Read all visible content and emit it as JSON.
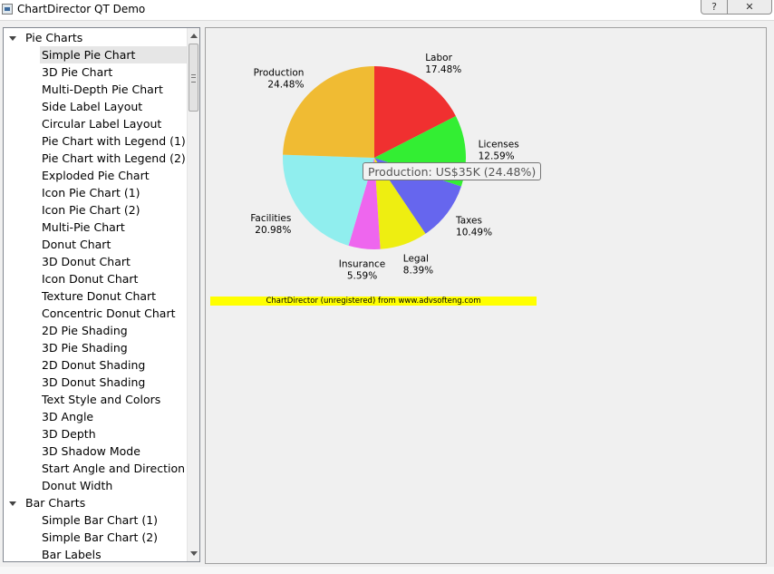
{
  "window": {
    "title": "ChartDirector QT Demo",
    "help_label": "?",
    "close_label": "✕"
  },
  "tree": {
    "rows": [
      {
        "label": "Pie Charts",
        "type": "group"
      },
      {
        "label": "Simple Pie Chart",
        "type": "leaf",
        "selected": true
      },
      {
        "label": "3D Pie Chart",
        "type": "leaf"
      },
      {
        "label": "Multi-Depth Pie Chart",
        "type": "leaf"
      },
      {
        "label": "Side Label Layout",
        "type": "leaf"
      },
      {
        "label": "Circular Label Layout",
        "type": "leaf"
      },
      {
        "label": "Pie Chart with Legend (1)",
        "type": "leaf"
      },
      {
        "label": "Pie Chart with Legend (2)",
        "type": "leaf"
      },
      {
        "label": "Exploded Pie Chart",
        "type": "leaf"
      },
      {
        "label": "Icon Pie Chart (1)",
        "type": "leaf"
      },
      {
        "label": "Icon Pie Chart (2)",
        "type": "leaf"
      },
      {
        "label": "Multi-Pie Chart",
        "type": "leaf"
      },
      {
        "label": "Donut Chart",
        "type": "leaf"
      },
      {
        "label": "3D Donut Chart",
        "type": "leaf"
      },
      {
        "label": "Icon Donut Chart",
        "type": "leaf"
      },
      {
        "label": "Texture Donut Chart",
        "type": "leaf"
      },
      {
        "label": "Concentric Donut Chart",
        "type": "leaf"
      },
      {
        "label": "2D Pie Shading",
        "type": "leaf"
      },
      {
        "label": "3D Pie Shading",
        "type": "leaf"
      },
      {
        "label": "2D Donut Shading",
        "type": "leaf"
      },
      {
        "label": "3D Donut Shading",
        "type": "leaf"
      },
      {
        "label": "Text Style and Colors",
        "type": "leaf"
      },
      {
        "label": "3D Angle",
        "type": "leaf"
      },
      {
        "label": "3D Depth",
        "type": "leaf"
      },
      {
        "label": "3D Shadow Mode",
        "type": "leaf"
      },
      {
        "label": "Start Angle and Direction",
        "type": "leaf"
      },
      {
        "label": "Donut Width",
        "type": "leaf"
      },
      {
        "label": "Bar Charts",
        "type": "group"
      },
      {
        "label": "Simple Bar Chart (1)",
        "type": "leaf"
      },
      {
        "label": "Simple Bar Chart (2)",
        "type": "leaf"
      },
      {
        "label": "Bar Labels",
        "type": "leaf"
      }
    ]
  },
  "chart_data": {
    "type": "pie",
    "categories": [
      "Labor",
      "Licenses",
      "Taxes",
      "Legal",
      "Insurance",
      "Facilities",
      "Production"
    ],
    "percent_labels": [
      "17.48%",
      "12.59%",
      "10.49%",
      "8.39%",
      "5.59%",
      "20.98%",
      "24.48%"
    ],
    "values": [
      25,
      18,
      15,
      12,
      8,
      30,
      35
    ],
    "colors": [
      "#f03030",
      "#33ee33",
      "#6666ee",
      "#eeee11",
      "#ee66ee",
      "#90eeee",
      "#f0bb33"
    ],
    "start_angle_deg": 0,
    "direction": "clockwise"
  },
  "tooltip": {
    "text": "Production: US$35K (24.48%)"
  },
  "watermark": {
    "text": "ChartDirector (unregistered) from www.advsofteng.com",
    "color": "#ffff00"
  }
}
